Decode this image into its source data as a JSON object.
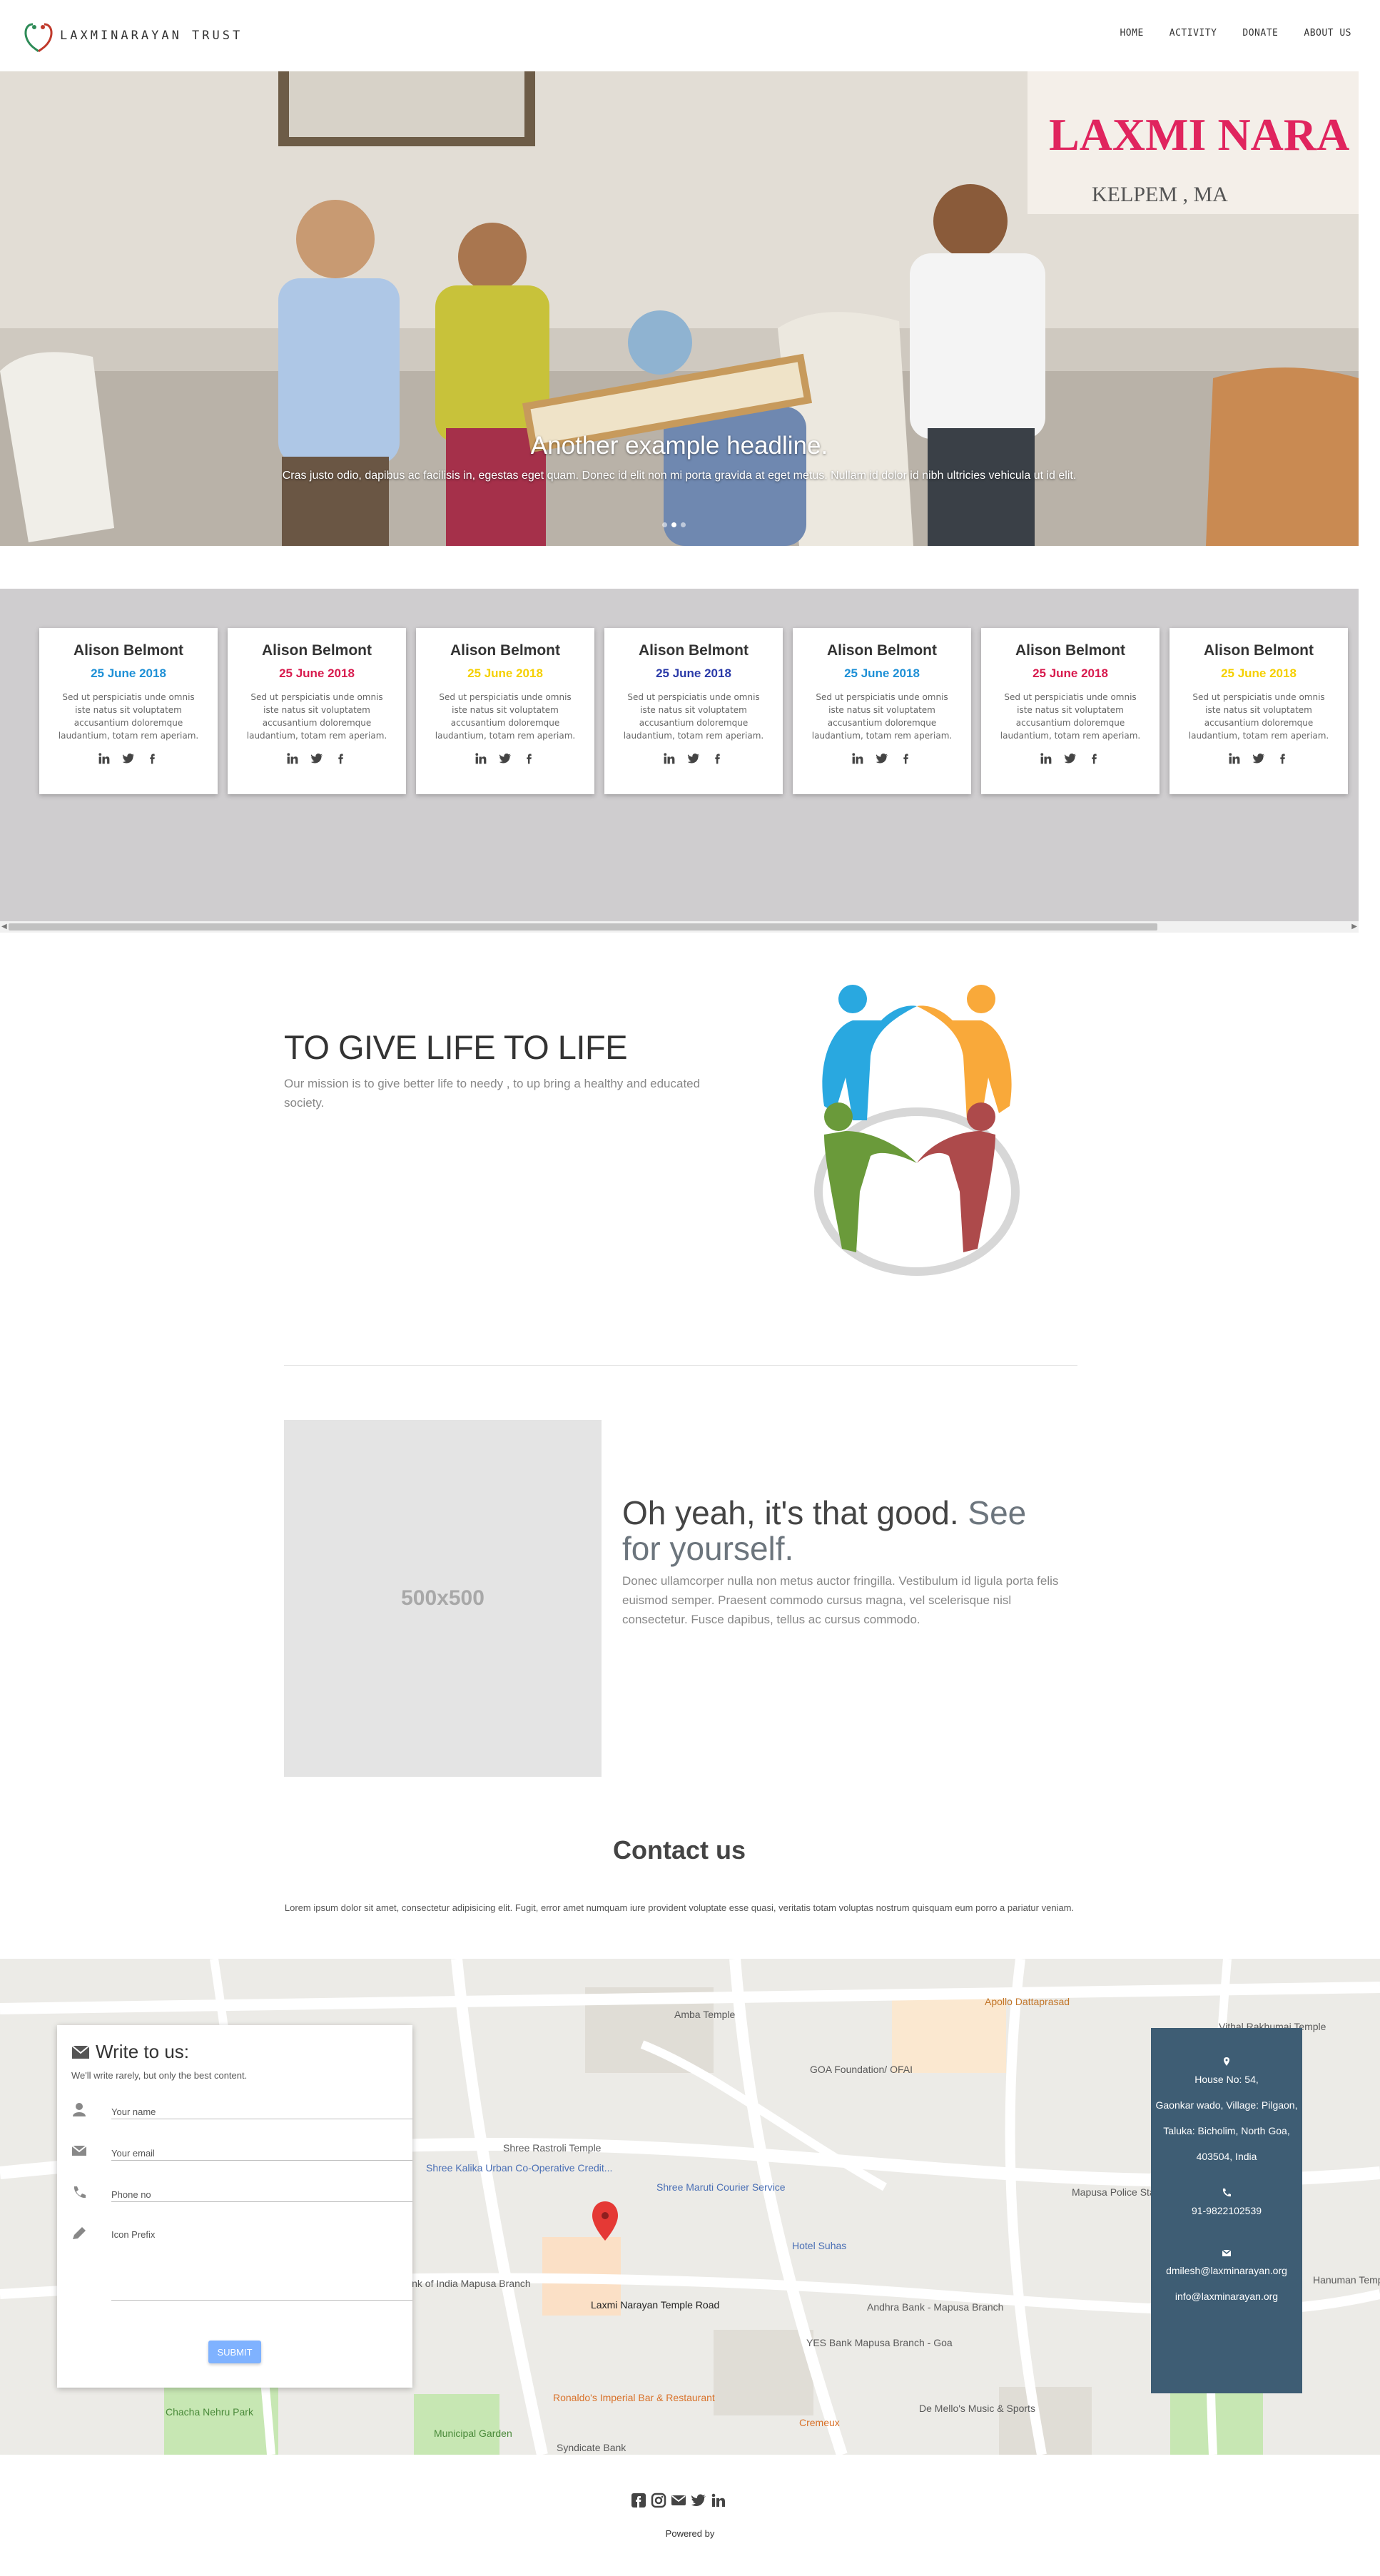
{
  "navbar": {
    "brand": "LAXMINARAYAN TRUST",
    "links": [
      "HOME",
      "ACTIVITY",
      "DONATE",
      "ABOUT US"
    ]
  },
  "carousel": {
    "banner_text": "LAXMI NARA",
    "banner_sub": "KELPEM , MA",
    "headline": "Another example headline.",
    "text": "Cras justo odio, dapibus ac facilisis in, egestas eget quam. Donec id elit non mi porta gravida at eget metus. Nullam id dolor id nibh ultricies vehicula ut id elit.",
    "slides": 3,
    "active_slide": 2
  },
  "team": {
    "cards": [
      {
        "name": "Alison Belmont",
        "date": "25 June 2018",
        "date_color": "#1e90d6",
        "text": "Sed ut perspiciatis unde omnis iste natus sit voluptatem accusantium doloremque laudantium, totam rem aperiam."
      },
      {
        "name": "Alison Belmont",
        "date": "25 June 2018",
        "date_color": "#d81b4e",
        "text": "Sed ut perspiciatis unde omnis iste natus sit voluptatem accusantium doloremque laudantium, totam rem aperiam."
      },
      {
        "name": "Alison Belmont",
        "date": "25 June 2018",
        "date_color": "#f5d000",
        "text": "Sed ut perspiciatis unde omnis iste natus sit voluptatem accusantium doloremque laudantium, totam rem aperiam."
      },
      {
        "name": "Alison Belmont",
        "date": "25 June 2018",
        "date_color": "#2a3aa8",
        "text": "Sed ut perspiciatis unde omnis iste natus sit voluptatem accusantium doloremque laudantium, totam rem aperiam."
      },
      {
        "name": "Alison Belmont",
        "date": "25 June 2018",
        "date_color": "#1e90d6",
        "text": "Sed ut perspiciatis unde omnis iste natus sit voluptatem accusantium doloremque laudantium, totam rem aperiam."
      },
      {
        "name": "Alison Belmont",
        "date": "25 June 2018",
        "date_color": "#d81b4e",
        "text": "Sed ut perspiciatis unde omnis iste natus sit voluptatem accusantium doloremque laudantium, totam rem aperiam."
      },
      {
        "name": "Alison Belmont",
        "date": "25 June 2018",
        "date_color": "#f5d000",
        "text": "Sed ut perspiciatis unde omnis iste natus sit voluptatem accusantium doloremque laudantium, totam rem aperiam."
      }
    ],
    "social_icons": [
      "linkedin-icon",
      "twitter-icon",
      "facebook-icon"
    ]
  },
  "mission": {
    "title": "TO GIVE LIFE TO LIFE",
    "text": "Our mission is to give better life to needy , to up bring a healthy and educated society."
  },
  "feature": {
    "placeholder": "500x500",
    "heading": "Oh yeah, it's that good.",
    "heading_muted": "See for yourself.",
    "text": "Donec ullamcorper nulla non metus auctor fringilla. Vestibulum id ligula porta felis euismod semper. Praesent commodo cursus magna, vel scelerisque nisl consectetur. Fusce dapibus, tellus ac cursus commodo."
  },
  "contact": {
    "title": "Contact us",
    "text": "Lorem ipsum dolor sit amet, consectetur adipisicing elit. Fugit, error amet numquam iure provident voluptate esse quasi, veritatis totam voluptas nostrum quisquam eum porro a pariatur veniam.",
    "form": {
      "title": "Write to us:",
      "subtitle": "We'll write rarely, but only the best content.",
      "name_placeholder": "Your name",
      "email_placeholder": "Your email",
      "phone_placeholder": "Phone no",
      "message_placeholder": "Icon Prefix",
      "submit": "SUBMIT"
    },
    "address": {
      "line1": "House No: 54,",
      "line2": "Gaonkar wado, Village: Pilgaon,",
      "line3": "Taluka: Bicholim, North Goa,",
      "line4": "403504, India",
      "phone": "91-9822102539",
      "email1": "dmilesh@laxminarayan.org",
      "email2": "info@laxminarayan.org"
    },
    "map_labels": [
      "Amba Temple",
      "Apollo Dattaprasad",
      "GOA Foundation/ OFAI",
      "Shree Rastroli Temple",
      "Shree Kalika Urban Co-Operative Credit...",
      "Shree Maruti Courier Service",
      "Hotel Suhas",
      "Laxmi Narayan Temple Road",
      "Andhra Bank - Mapusa Branch",
      "YES Bank Mapusa Branch - Goa",
      "Chacha Nehru Park",
      "Municipal Garden",
      "Ronaldo's Imperial Bar & Restaurant",
      "Cremeux",
      "De Mello's Music & Sports",
      "Mapusa Police Station",
      "Bank of India Mapusa Branch",
      "Vithal Rakhumai Temple",
      "Hanuman Temple",
      "Syndicate Bank"
    ]
  },
  "footer": {
    "icons": [
      "facebook-square-icon",
      "instagram-icon",
      "envelope-icon",
      "twitter-icon",
      "linkedin-icon"
    ],
    "powered": "Powered by"
  }
}
